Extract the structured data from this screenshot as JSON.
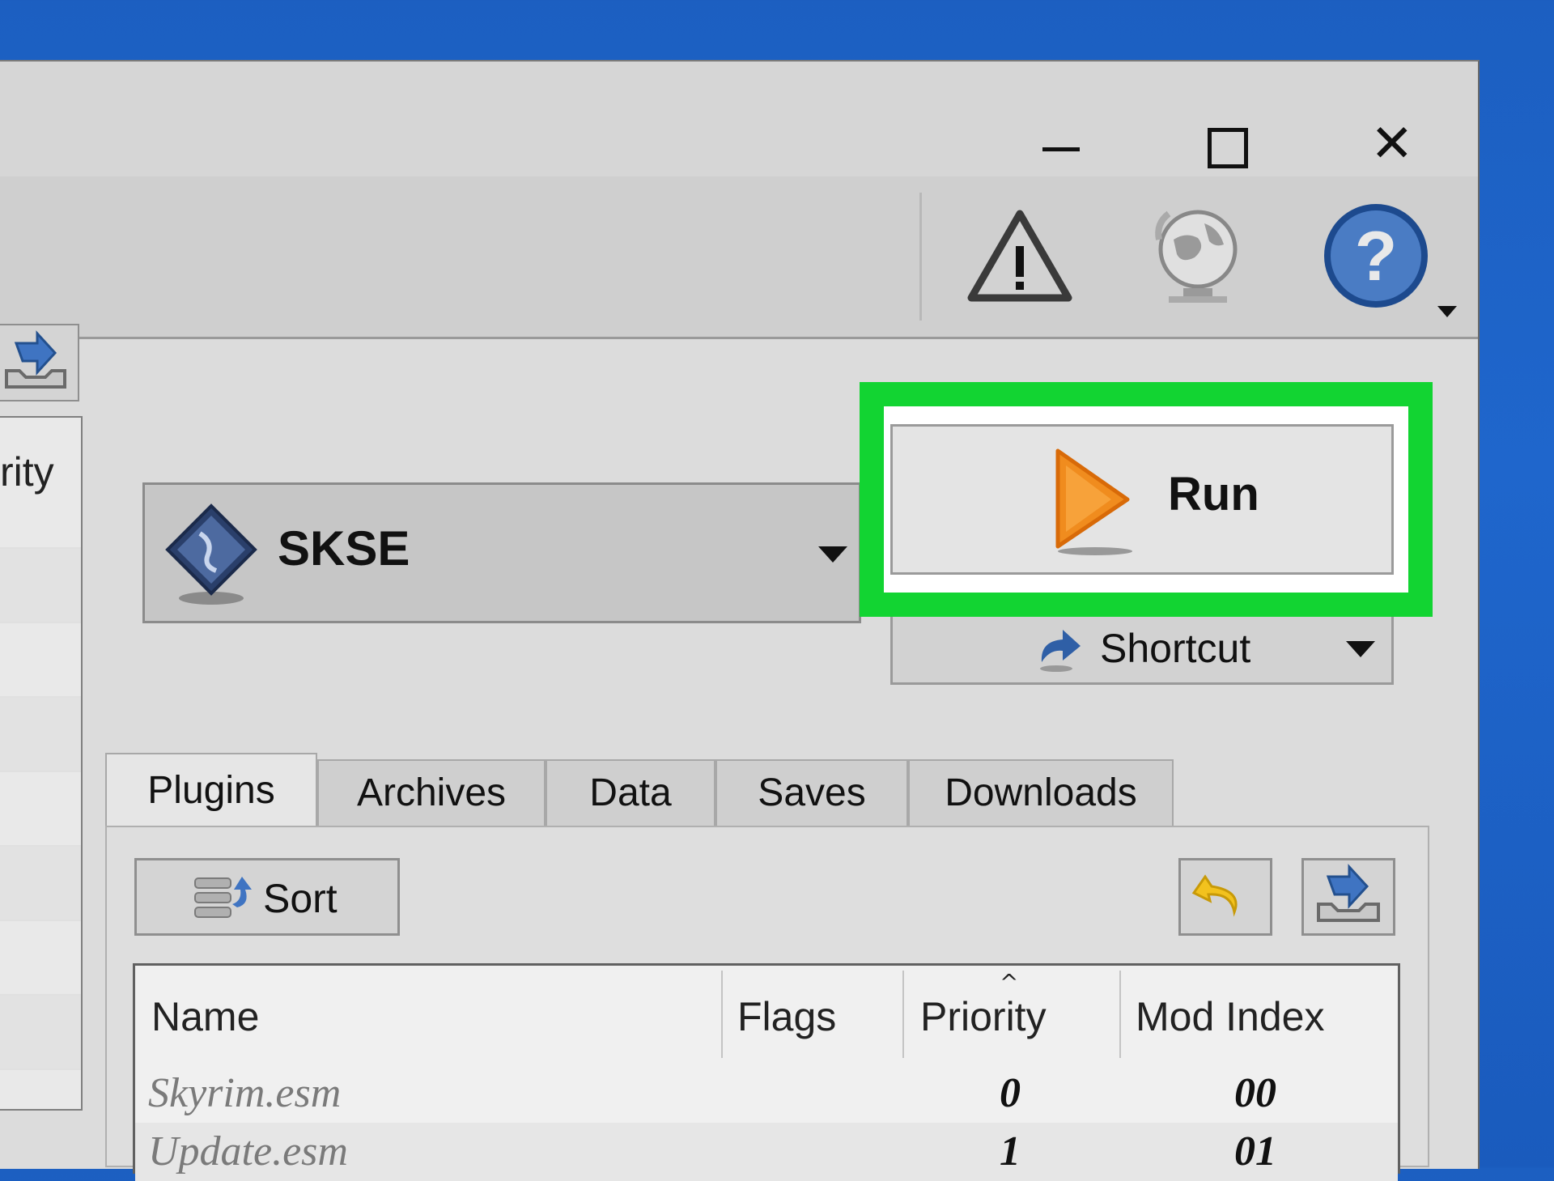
{
  "window": {
    "controls": {
      "minimize": "minimize",
      "maximize": "maximize",
      "close": "✕"
    }
  },
  "toolbar": {
    "icons": [
      "warning-icon",
      "globe-update-icon",
      "help-icon"
    ]
  },
  "left_panel": {
    "header_fragment": "rity"
  },
  "executable": {
    "selected": "SKSE"
  },
  "run": {
    "label": "Run"
  },
  "shortcut": {
    "label": "Shortcut"
  },
  "tabs": [
    {
      "label": "Plugins",
      "active": true
    },
    {
      "label": "Archives",
      "active": false
    },
    {
      "label": "Data",
      "active": false
    },
    {
      "label": "Saves",
      "active": false
    },
    {
      "label": "Downloads",
      "active": false
    }
  ],
  "plugins": {
    "sort_label": "Sort",
    "columns": [
      "Name",
      "Flags",
      "Priority",
      "Mod Index"
    ],
    "rows": [
      {
        "name": "Skyrim.esm",
        "flags": "",
        "priority": "0",
        "mod_index": "00"
      },
      {
        "name": "Update.esm",
        "flags": "",
        "priority": "1",
        "mod_index": "01"
      }
    ]
  },
  "colors": {
    "highlight": "#12d432",
    "run_icon": "#f08c1e",
    "desktop": "#1c5fc1"
  }
}
